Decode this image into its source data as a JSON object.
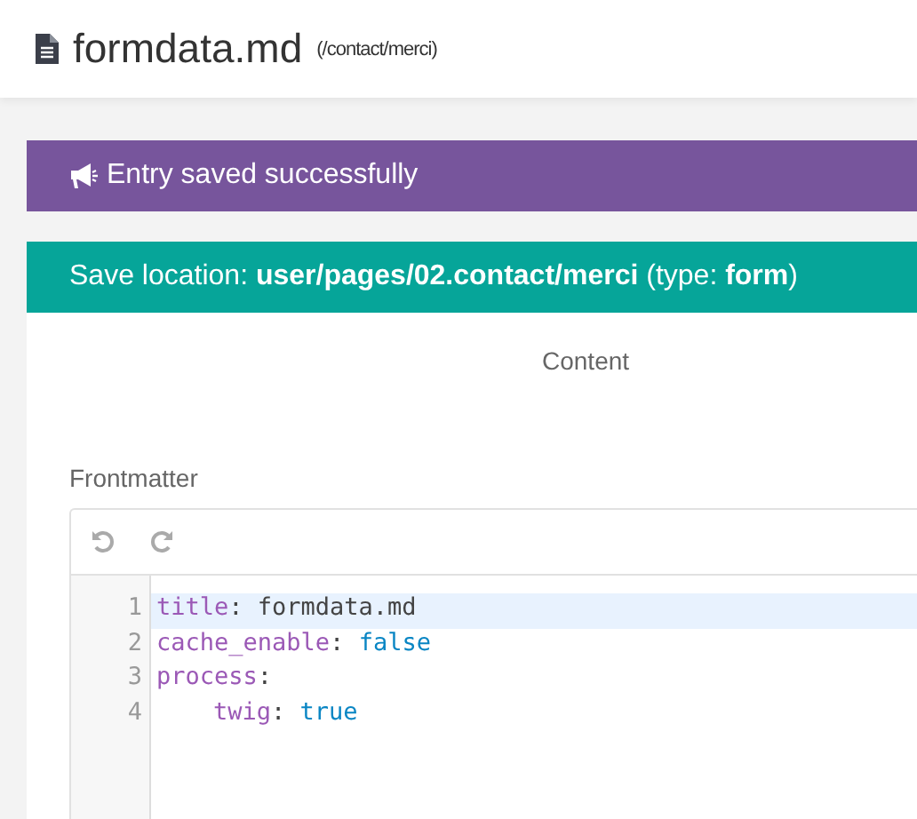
{
  "header": {
    "title": "formdata.md",
    "route": "(/contact/merci)"
  },
  "alerts": [
    {
      "kind": "info",
      "text": "Entry saved successfully"
    },
    {
      "kind": "location",
      "text": "Save location: **user/pages/02.contact/merci** (type: **form**)"
    }
  ],
  "tabs": [
    {
      "label": "Content",
      "selected": true
    }
  ],
  "section_label": "Frontmatter",
  "editor": {
    "lines": [
      {
        "number": "1",
        "selected": true,
        "indented": false,
        "tokens": [
          {
            "kind": "key",
            "text": "title"
          },
          {
            "kind": "punct",
            "text": ": "
          },
          {
            "kind": "string",
            "text": "formdata.md"
          }
        ]
      },
      {
        "number": "2",
        "selected": false,
        "indented": false,
        "tokens": [
          {
            "kind": "key",
            "text": "cache_enable"
          },
          {
            "kind": "punct",
            "text": ": "
          },
          {
            "kind": "bool",
            "text": "false"
          }
        ]
      },
      {
        "number": "3",
        "selected": false,
        "indented": false,
        "tokens": [
          {
            "kind": "key",
            "text": "process"
          },
          {
            "kind": "punct",
            "text": ":"
          }
        ]
      },
      {
        "number": "4",
        "selected": false,
        "indented": true,
        "tokens": [
          {
            "kind": "key",
            "text": "twig"
          },
          {
            "kind": "punct",
            "text": ": "
          },
          {
            "kind": "bool",
            "text": "true"
          }
        ]
      }
    ]
  }
}
